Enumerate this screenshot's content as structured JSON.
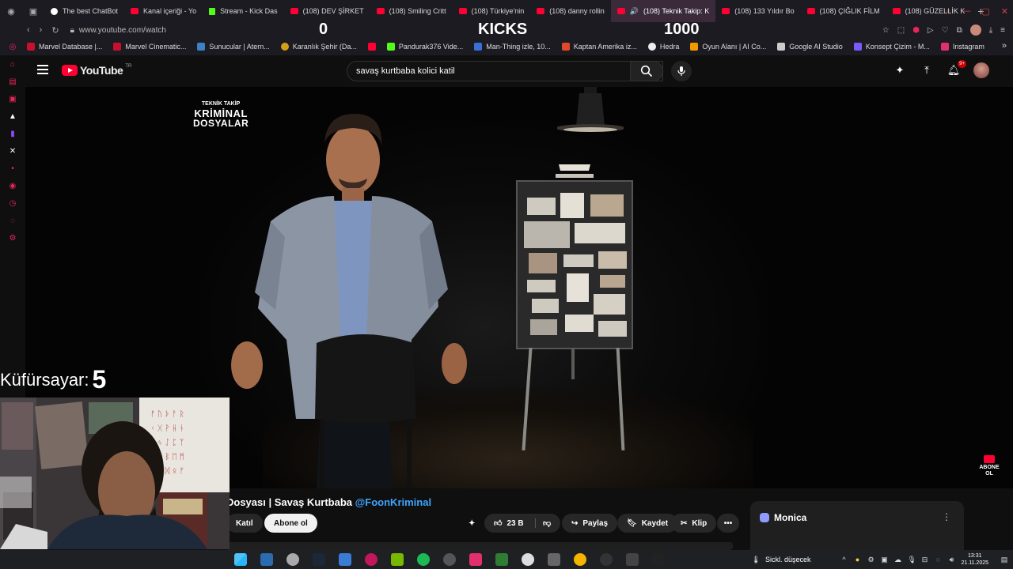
{
  "browser": {
    "tabs": [
      {
        "title": "The best ChatBot",
        "icon": "chatbot-icon",
        "active": false
      },
      {
        "title": "Kanal içeriği - Yo",
        "icon": "youtube-icon",
        "active": false
      },
      {
        "title": "Stream - Kick Das",
        "icon": "kick-icon",
        "active": false
      },
      {
        "title": "(108) DEV ŞİRKET",
        "icon": "youtube-icon",
        "active": false
      },
      {
        "title": "(108) Smiling Critt",
        "icon": "youtube-icon",
        "active": false
      },
      {
        "title": "(108) Türkiye'nin",
        "icon": "youtube-icon",
        "active": false
      },
      {
        "title": "(108) danny rollin",
        "icon": "youtube-icon",
        "active": false
      },
      {
        "title": "(108) Teknik Takip: K",
        "icon": "youtube-icon",
        "active": true
      },
      {
        "title": "(108) 133 Yıldır Bo",
        "icon": "youtube-icon",
        "active": false
      },
      {
        "title": "(108) ÇIĞLIK FİLM",
        "icon": "youtube-icon",
        "active": false
      },
      {
        "title": "(108) GÜZELLİK K",
        "icon": "youtube-icon",
        "active": false
      }
    ],
    "url": "www.youtube.com/watch",
    "bookmarks": [
      {
        "label": "Marvel Database |...",
        "color": "#c8102e"
      },
      {
        "label": "Marvel Cinematic...",
        "color": "#c8102e"
      },
      {
        "label": "Sunucular | Atern...",
        "color": "#3b82c4"
      },
      {
        "label": "Karanlık Şehir (Da...",
        "color": "#d4a017"
      },
      {
        "label": "",
        "color": "#ff0033"
      },
      {
        "label": "Pandurak376 Vide...",
        "color": "#53fc18"
      },
      {
        "label": "Man-Thing izle, 10...",
        "color": "#3a6fd8"
      },
      {
        "label": "Kaptan Amerika iz...",
        "color": "#e0472b"
      },
      {
        "label": "Hedra",
        "color": "#eeeeee"
      },
      {
        "label": "Oyun Alanı | AI Co...",
        "color": "#f29900"
      },
      {
        "label": "Google AI Studio",
        "color": "#cccccc"
      },
      {
        "label": "Konsept Çizim - M...",
        "color": "#7a5af8"
      },
      {
        "label": "Instagram",
        "color": "#e1306c"
      }
    ]
  },
  "stream_overlay": {
    "left_count": "0",
    "label": "KICKS",
    "right_count": "1000",
    "swear_label": "Küfürsayar:",
    "swear_count": "5"
  },
  "youtube": {
    "logo_text": "YouTube",
    "country_code": "TR",
    "search_value": "savaş kurtbaba kolici katil",
    "notification_badge": "9+",
    "video": {
      "channel_logo_line1": "TEKNİK TAKİP",
      "channel_logo_line2": "KRİMİNAL",
      "channel_logo_line3": "DOSYALAR",
      "subscribe_watermark": "ABONE OL"
    },
    "title_text": "Dosyası | Savaş Kurtbaba ",
    "title_mention": "@FoonKriminal",
    "join_label": "Katıl",
    "subscribe_label": "Abone ol",
    "like_count": "23 B",
    "share_label": "Paylaş",
    "save_label": "Kaydet",
    "clip_label": "Klip"
  },
  "monica": {
    "title": "Monica"
  },
  "taskbar": {
    "weather": "Sickl. düşecek",
    "time": "13:31",
    "date": "21.11.2025"
  },
  "colors": {
    "youtube_red": "#ff0033",
    "kick_green": "#53fc18",
    "link_blue": "#3ea6ff"
  }
}
